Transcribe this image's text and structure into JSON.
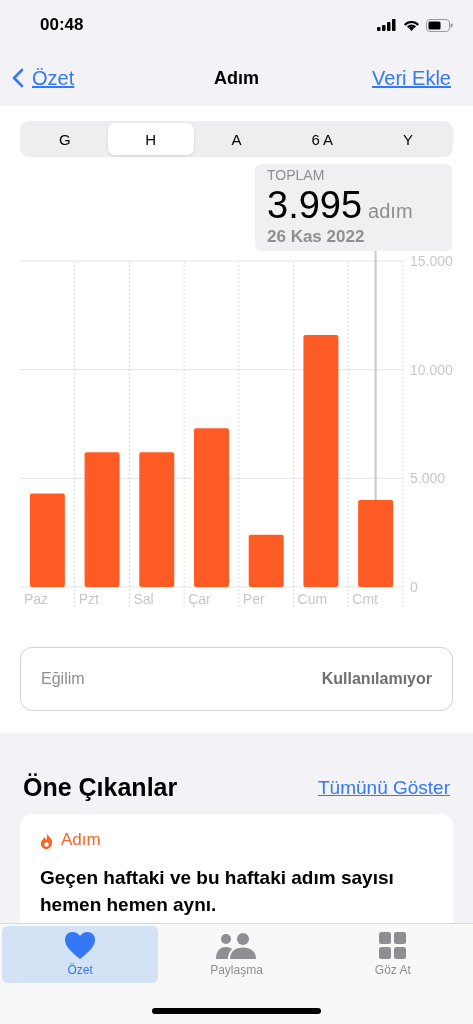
{
  "status_bar": {
    "time": "00:48"
  },
  "nav": {
    "back": "Özet",
    "title": "Adım",
    "action": "Veri Ekle"
  },
  "segments": [
    {
      "label": "G",
      "selected": false
    },
    {
      "label": "H",
      "selected": true
    },
    {
      "label": "A",
      "selected": false
    },
    {
      "label": "6 A",
      "selected": false
    },
    {
      "label": "Y",
      "selected": false
    }
  ],
  "summary": {
    "label": "TOPLAM",
    "value": "3.995",
    "unit": "adım",
    "date": "26 Kas 2022"
  },
  "chart_data": {
    "type": "bar",
    "categories": [
      "Paz",
      "Pzt",
      "Sal",
      "Çar",
      "Per",
      "Cum",
      "Cmt"
    ],
    "series": [
      {
        "color": "#ff5b24",
        "values": [
          4300,
          6200,
          6200,
          7300,
          2400,
          11600,
          4000
        ]
      }
    ],
    "ylim": [
      0,
      15000
    ],
    "yticks": [
      {
        "value": 0,
        "label": "0"
      },
      {
        "value": 5000,
        "label": "5.000"
      },
      {
        "value": 10000,
        "label": "10.000"
      },
      {
        "value": 15000,
        "label": "15.000"
      }
    ]
  },
  "trend": {
    "label": "Eğilim",
    "value": "Kullanılamıyor"
  },
  "highlights": {
    "title": "Öne Çıkanlar",
    "link": "Tümünü Göster",
    "card": {
      "category": "Adım",
      "text": "Geçen haftaki ve bu haftaki adım sayısı hemen hemen aynı."
    }
  },
  "tab_bar": [
    {
      "label": "Özet",
      "kind": "heart",
      "selected": true
    },
    {
      "label": "Paylaşma",
      "kind": "people",
      "selected": false
    },
    {
      "label": "Göz At",
      "kind": "grid",
      "selected": false
    }
  ]
}
